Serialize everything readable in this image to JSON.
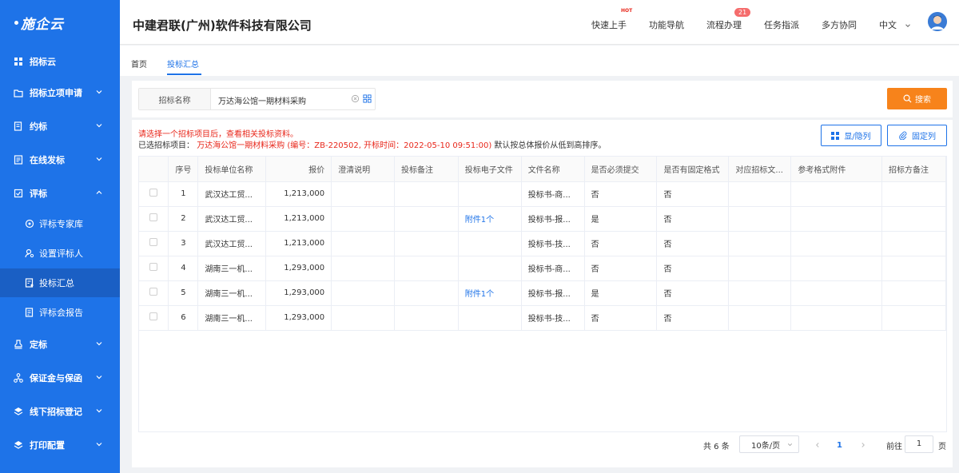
{
  "app": {
    "logo": "施企云"
  },
  "sidebar": {
    "items": [
      {
        "label": "招标云",
        "icon": "grid-icon"
      },
      {
        "label": "招标立项申请",
        "icon": "folder-icon"
      },
      {
        "label": "约标",
        "icon": "document-icon"
      },
      {
        "label": "在线发标",
        "icon": "list-document-icon"
      },
      {
        "label": "评标",
        "icon": "checklist-icon"
      },
      {
        "label": "定标",
        "icon": "stamp-icon"
      },
      {
        "label": "保证金与保函",
        "icon": "network-icon"
      },
      {
        "label": "线下招标登记",
        "icon": "layers-icon"
      },
      {
        "label": "打印配置",
        "icon": "layers-icon"
      }
    ],
    "sub_items": [
      {
        "label": "评标专家库",
        "icon": "expert-icon"
      },
      {
        "label": "设置评标人",
        "icon": "user-setting-icon"
      },
      {
        "label": "投标汇总",
        "icon": "summary-icon",
        "active": true
      },
      {
        "label": "评标会报告",
        "icon": "report-icon"
      }
    ]
  },
  "header": {
    "company": "中建君联(广州)软件科技有限公司",
    "nav": [
      "快速上手",
      "功能导航",
      "流程办理",
      "任务指派",
      "多方协同"
    ],
    "hot_label": "HOT",
    "process_badge": "21",
    "language": "中文"
  },
  "tabs": {
    "home": "首页",
    "current": "投标汇总"
  },
  "search": {
    "label": "招标名称",
    "value": "万达海公馆一期材料采购",
    "button": "搜索"
  },
  "info": {
    "hint": "请选择一个招标项目后，查看相关投标资料。",
    "selected_prefix": "已选招标项目：",
    "selected_project": "万达海公馆一期材料采购 (编号：ZB-220502, 开标时间：2022-05-10 09:51:00)",
    "selected_suffix": "默认按总体报价从低到高排序。"
  },
  "buttons": {
    "toggle_columns": "显/隐列",
    "fix_columns": "固定列"
  },
  "table": {
    "headers": [
      "",
      "序号",
      "投标单位名称",
      "报价",
      "澄清说明",
      "投标备注",
      "投标电子文件",
      "文件名称",
      "是否必须提交",
      "是否有固定格式",
      "对应招标文...",
      "参考格式附件",
      "招标方备注"
    ],
    "rows": [
      {
        "index": "1",
        "company": "武汉达工贸...",
        "price": "1,213,000",
        "file": "",
        "filename": "投标书-商...",
        "required": "否",
        "fixed": "否"
      },
      {
        "index": "2",
        "company": "武汉达工贸...",
        "price": "1,213,000",
        "file": "附件1个",
        "filename": "投标书-报...",
        "required": "是",
        "fixed": "否"
      },
      {
        "index": "3",
        "company": "武汉达工贸...",
        "price": "1,213,000",
        "file": "",
        "filename": "投标书-技...",
        "required": "否",
        "fixed": "否"
      },
      {
        "index": "4",
        "company": "湖南三一机...",
        "price": "1,293,000",
        "file": "",
        "filename": "投标书-商...",
        "required": "否",
        "fixed": "否"
      },
      {
        "index": "5",
        "company": "湖南三一机...",
        "price": "1,293,000",
        "file": "附件1个",
        "filename": "投标书-报...",
        "required": "是",
        "fixed": "否"
      },
      {
        "index": "6",
        "company": "湖南三一机...",
        "price": "1,293,000",
        "file": "",
        "filename": "投标书-技...",
        "required": "否",
        "fixed": "否"
      }
    ]
  },
  "pagination": {
    "total": "共 6 条",
    "page_size": "10条/页",
    "current_page": "1",
    "goto_prefix": "前往",
    "goto_value": "1",
    "goto_suffix": "页"
  },
  "colors": {
    "primary": "#1e73e8",
    "accent": "#f7831b",
    "danger": "#e8271b"
  }
}
